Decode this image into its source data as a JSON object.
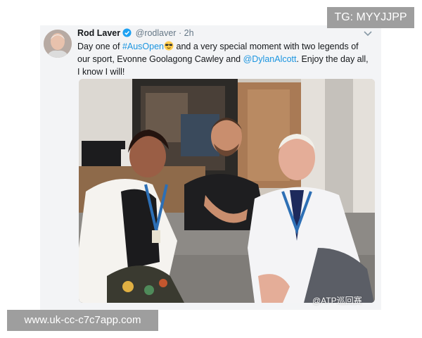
{
  "tweet": {
    "author_name": "Rod Laver",
    "handle": "@rodlaver",
    "separator": "·",
    "time": "2h",
    "text_1": "Day one of ",
    "hashtag": "#AusOpen",
    "emoji": "sunglasses-emoji",
    "text_2": " and a very special moment with two legends of our sport, Evonne Goolagong Cawley and ",
    "mention": "@DylanAlcott",
    "text_3": ". Enjoy the day all, I know I will!",
    "accent_color": "#1b95e0",
    "verified_color": "#1da1f2",
    "photo_watermark": "@ATP巡回赛"
  },
  "overlay": {
    "top_right_label": "TG: MYYJJPP",
    "bottom_left_label": "www.uk-cc-c7c7app.com"
  }
}
